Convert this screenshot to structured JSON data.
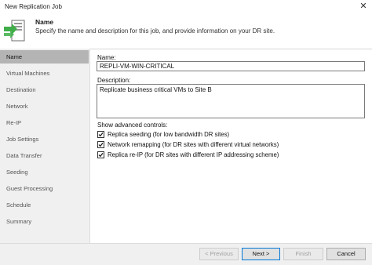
{
  "window": {
    "title": "New Replication Job"
  },
  "header": {
    "title": "Name",
    "description": "Specify the name and description for this job, and provide information on your DR site."
  },
  "sidebar": {
    "items": [
      {
        "label": "Name",
        "active": true
      },
      {
        "label": "Virtual Machines"
      },
      {
        "label": "Destination"
      },
      {
        "label": "Network"
      },
      {
        "label": "Re-IP"
      },
      {
        "label": "Job Settings"
      },
      {
        "label": "Data Transfer"
      },
      {
        "label": "Seeding"
      },
      {
        "label": "Guest Processing"
      },
      {
        "label": "Schedule"
      },
      {
        "label": "Summary"
      }
    ]
  },
  "form": {
    "name_label": "Name:",
    "name_value": "REPLI-VM-WIN-CRITICAL",
    "description_label": "Description:",
    "description_value": "Replicate business critical VMs to Site B",
    "advanced_label": "Show advanced controls:",
    "checkboxes": [
      {
        "label": "Replica seeding (for low bandwidth DR sites)",
        "checked": true
      },
      {
        "label": "Network remapping (for DR sites with different virtual networks)",
        "checked": true
      },
      {
        "label": "Replica re-IP (for DR sites with different IP addressing scheme)",
        "checked": true
      }
    ]
  },
  "footer": {
    "previous": "< Previous",
    "next": "Next >",
    "finish": "Finish",
    "cancel": "Cancel"
  },
  "icons": {
    "logo": "replication-job-icon",
    "close": "close-icon",
    "check": "check-icon"
  },
  "colors": {
    "accent": "#0078d7",
    "logo_green": "#3fae49",
    "sidebar_active": "#b4b4b4"
  }
}
